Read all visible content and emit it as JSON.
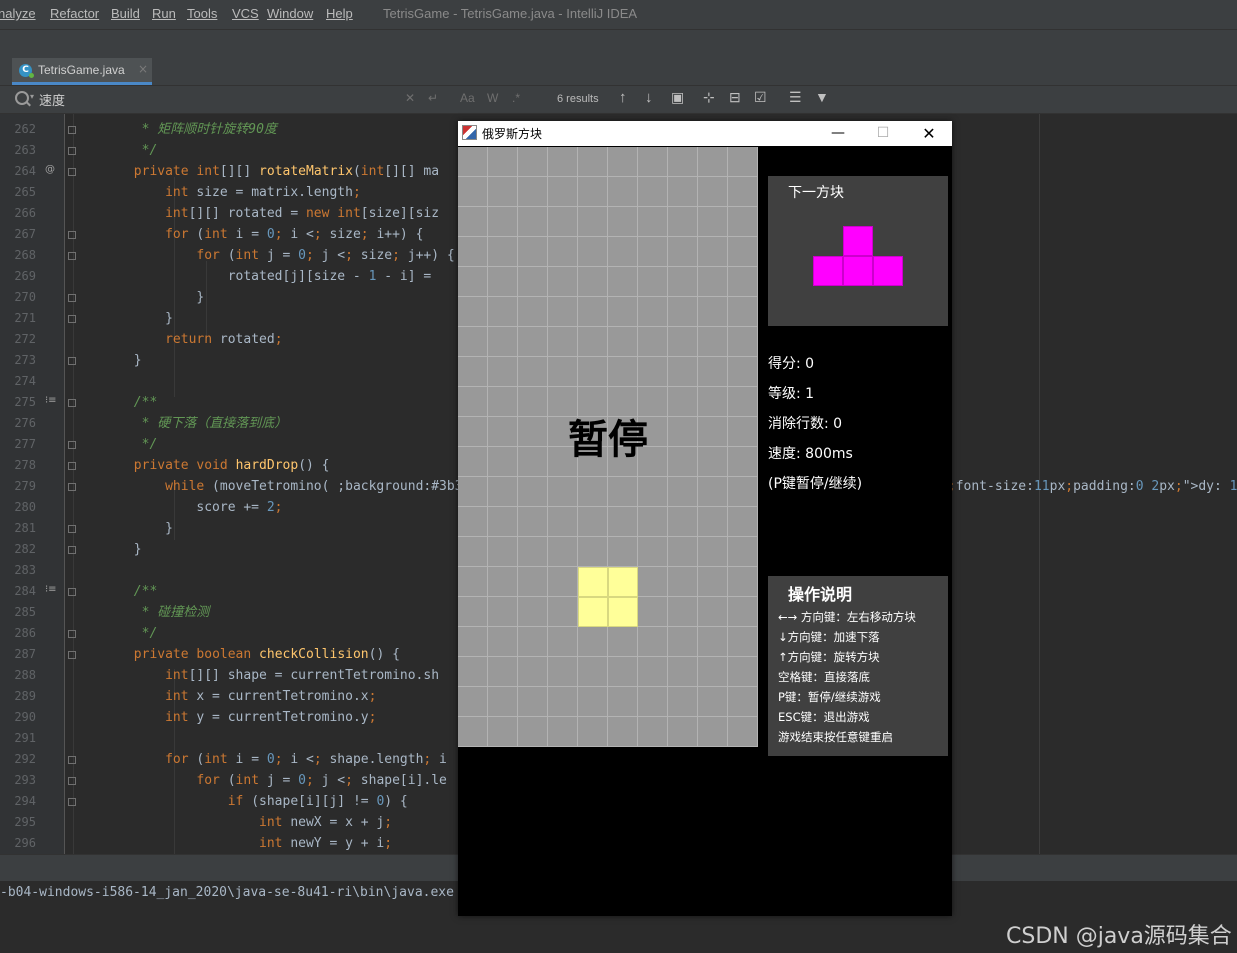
{
  "menubar": {
    "items": [
      "nalyze",
      "Refactor",
      "Build",
      "Run",
      "Tools",
      "VCS",
      "Window",
      "Help"
    ],
    "title": "TetrisGame - TetrisGame.java - IntelliJ IDEA"
  },
  "tab": {
    "label": "TetrisGame.java",
    "close": "×"
  },
  "search": {
    "value": "速度",
    "results": "6 results"
  },
  "editor": {
    "lines": [
      {
        "n": "262",
        "t": "        * 矩阵顺时针旋转90度"
      },
      {
        "n": "263",
        "t": "        */"
      },
      {
        "n": "264",
        "t": "       private int[][] rotateMatrix(int[][] ma"
      },
      {
        "n": "265",
        "t": "           int size = matrix.length;"
      },
      {
        "n": "266",
        "t": "           int[][] rotated = new int[size][siz"
      },
      {
        "n": "267",
        "t": "           for (int i = 0; i < size; i++) {"
      },
      {
        "n": "268",
        "t": "               for (int j = 0; j < size; j++) {"
      },
      {
        "n": "269",
        "t": "                   rotated[j][size - 1 - i] = "
      },
      {
        "n": "270",
        "t": "               }"
      },
      {
        "n": "271",
        "t": "           }"
      },
      {
        "n": "272",
        "t": "           return rotated;"
      },
      {
        "n": "273",
        "t": "       }"
      },
      {
        "n": "274",
        "t": ""
      },
      {
        "n": "275",
        "t": "       /**"
      },
      {
        "n": "276",
        "t": "        * 硬下落（直接落到底）"
      },
      {
        "n": "277",
        "t": "        */"
      },
      {
        "n": "278",
        "t": "       private void hardDrop() {"
      },
      {
        "n": "279",
        "t": "           while (moveTetromino( dx: 0,  dy: 1))"
      },
      {
        "n": "280",
        "t": "               score += 2;"
      },
      {
        "n": "281",
        "t": "           }"
      },
      {
        "n": "282",
        "t": "       }"
      },
      {
        "n": "283",
        "t": ""
      },
      {
        "n": "284",
        "t": "       /**"
      },
      {
        "n": "285",
        "t": "        * 碰撞检测"
      },
      {
        "n": "286",
        "t": "        */"
      },
      {
        "n": "287",
        "t": "       private boolean checkCollision() {"
      },
      {
        "n": "288",
        "t": "           int[][] shape = currentTetromino.sh"
      },
      {
        "n": "289",
        "t": "           int x = currentTetromino.x;"
      },
      {
        "n": "290",
        "t": "           int y = currentTetromino.y;"
      },
      {
        "n": "291",
        "t": ""
      },
      {
        "n": "292",
        "t": "           for (int i = 0; i < shape.length; i"
      },
      {
        "n": "293",
        "t": "               for (int j = 0; j < shape[i].le"
      },
      {
        "n": "294",
        "t": "                   if (shape[i][j] != 0) {"
      },
      {
        "n": "295",
        "t": "                       int newX = x + j;"
      },
      {
        "n": "296",
        "t": "                       int newY = y + i;"
      }
    ]
  },
  "console": {
    "text": "-b04-windows-i586-14_jan_2020\\java-se-8u41-ri\\bin\\java.exe"
  },
  "watermark": "CSDN @java源码集合",
  "game": {
    "title": "俄罗斯方块",
    "paused": "暂停",
    "next_title": "下一方块",
    "score": "得分: 0",
    "level": "等级: 1",
    "lines_cleared": "消除行数: 0",
    "speed": "速度: 800ms",
    "pause_hint": "(P键暂停/继续)",
    "help_title": "操作说明",
    "help": [
      "←→ 方向键：左右移动方块",
      "↓方向键：加速下落",
      "↑方向键：旋转方块",
      "空格键：直接落底",
      "P键：暂停/继续游戏",
      "ESC键：退出游戏",
      "游戏结束按任意键重启"
    ],
    "colors": {
      "board": "#999999",
      "piece": "#ffff99",
      "next_piece": "#ff00ff"
    },
    "board_cols": 10,
    "board_rows": 20,
    "active_piece_cells": [
      [
        4,
        14
      ],
      [
        5,
        14
      ],
      [
        4,
        15
      ],
      [
        5,
        15
      ]
    ],
    "next_piece_cells": [
      [
        1,
        0
      ],
      [
        0,
        1
      ],
      [
        1,
        1
      ],
      [
        2,
        1
      ]
    ]
  }
}
